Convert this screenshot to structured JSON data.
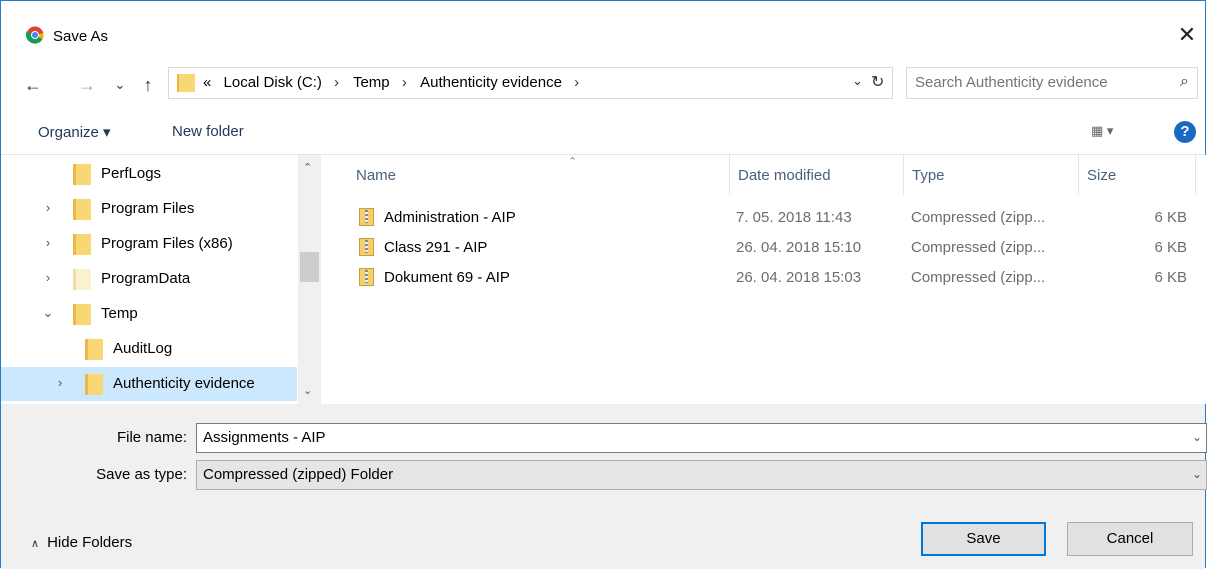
{
  "window": {
    "title": "Save As",
    "close_glyph": "✕"
  },
  "nav": {
    "back_glyph": "←",
    "forward_glyph": "→",
    "recent_glyph": "⌄",
    "up_glyph": "↑",
    "overflow": "«",
    "breadcrumbs": [
      "Local Disk (C:)",
      "Temp",
      "Authenticity evidence"
    ],
    "crumb_separator": "›",
    "dropdown_glyph": "⌄",
    "refresh_glyph": "↻",
    "search_placeholder": "Search Authenticity evidence",
    "search_glyph": "⌕"
  },
  "toolbar": {
    "organize": "Organize ▾",
    "new_folder": "New folder",
    "view": "▦ ▾",
    "help": "?"
  },
  "tree": {
    "scroll_up": "⌃",
    "scroll_down": "⌄",
    "items": [
      {
        "label": "PerfLogs",
        "arrow": ""
      },
      {
        "label": "Program Files",
        "arrow": "›"
      },
      {
        "label": "Program Files (x86)",
        "arrow": "›"
      },
      {
        "label": "ProgramData",
        "arrow": "›"
      },
      {
        "label": "Temp",
        "arrow": "⌄"
      },
      {
        "label": "AuditLog",
        "arrow": ""
      },
      {
        "label": "Authenticity evidence",
        "arrow": "›"
      }
    ]
  },
  "files": {
    "sort_caret": "⌃",
    "columns": [
      "Name",
      "Date modified",
      "Type",
      "Size"
    ],
    "rows": [
      {
        "name": "Administration - AIP",
        "date": "7. 05. 2018 11:43",
        "type": "Compressed (zipp...",
        "size": "6 KB"
      },
      {
        "name": "Class 291 - AIP",
        "date": "26. 04. 2018 15:10",
        "type": "Compressed (zipp...",
        "size": "6 KB"
      },
      {
        "name": "Dokument 69 - AIP",
        "date": "26. 04. 2018 15:03",
        "type": "Compressed (zipp...",
        "size": "6 KB"
      }
    ]
  },
  "form": {
    "file_name_label": "File name:",
    "file_name_value": "Assignments - AIP",
    "type_label": "Save as type:",
    "type_value": "Compressed (zipped) Folder",
    "dd_glyph": "⌄"
  },
  "footer": {
    "hide_folders": "Hide Folders",
    "hide_glyph": "∧",
    "save": "Save",
    "cancel": "Cancel"
  },
  "colors": {
    "accent": "#0078d7",
    "selection": "#cce8ff",
    "folder": "#f8d775"
  }
}
